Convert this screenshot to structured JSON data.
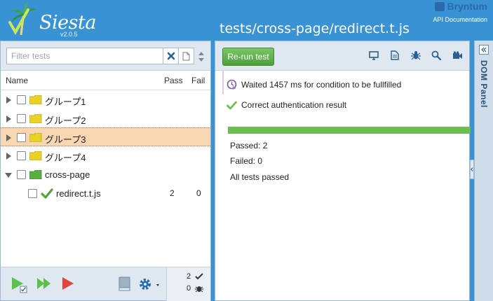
{
  "app": {
    "name": "Siesta",
    "version": "v2.0.5"
  },
  "brand": {
    "name": "Bryntum",
    "link": "API Documentation"
  },
  "page_title": "tests/cross-page/redirect.t.js",
  "filter": {
    "placeholder": "Filter tests",
    "value": ""
  },
  "grid": {
    "columns": {
      "name": "Name",
      "pass": "Pass",
      "fail": "Fail"
    },
    "rows": [
      {
        "label": "グループ1",
        "pass": "",
        "fail": ""
      },
      {
        "label": "グループ2",
        "pass": "",
        "fail": ""
      },
      {
        "label": "グループ3",
        "pass": "",
        "fail": ""
      },
      {
        "label": "グループ4",
        "pass": "",
        "fail": ""
      },
      {
        "label": "cross-page",
        "pass": "",
        "fail": ""
      },
      {
        "label": "redirect.t.js",
        "pass": "2",
        "fail": "0"
      }
    ]
  },
  "totals": {
    "passed": "2",
    "failed": "0"
  },
  "rerun_label": "Re-run test",
  "assertions": [
    {
      "text": "Waited 1457 ms for condition to be fullfilled",
      "icon": "clock-icon"
    },
    {
      "text": "Correct authentication result",
      "icon": "checkmark-icon"
    }
  ],
  "summary": {
    "passed": "Passed: 2",
    "failed": "Failed: 0",
    "status": "All tests passed"
  },
  "dom_panel_label": "DOM Panel",
  "colors": {
    "header": "#3892d3",
    "pass_green": "#6cbf4f",
    "selected_row": "#f8d6b2",
    "folder_yellow": "#e8d227",
    "folder_green": "#5cae43",
    "fail_red": "#e0443c"
  }
}
